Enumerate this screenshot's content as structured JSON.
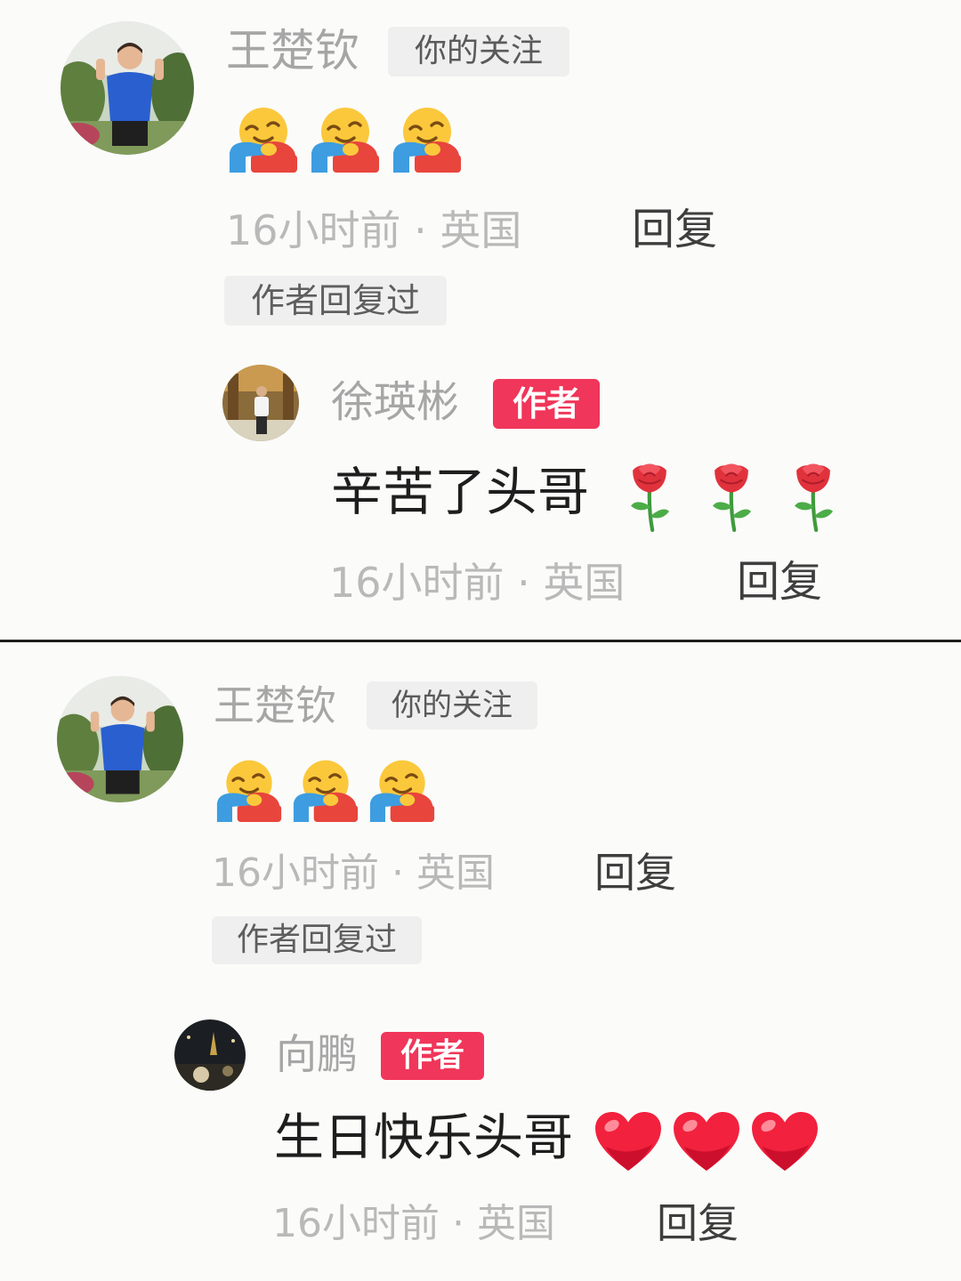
{
  "colors": {
    "background": "#fbfbfa",
    "author_badge": "#f0365a",
    "username": "#a6a6a6",
    "meta_text": "#b9b9b9",
    "tag_bg": "#efefef"
  },
  "screens": [
    {
      "comment": {
        "username": "王楚钦",
        "follow_tag": "你的关注",
        "emojis": [
          "hugging-face-emoji",
          "hugging-face-emoji",
          "hugging-face-emoji"
        ],
        "meta": "16小时前 · 英国",
        "reply_label": "回复",
        "replied_tag": "作者回复过"
      },
      "reply": {
        "username": "徐瑛彬",
        "author_tag": "作者",
        "text": "辛苦了头哥",
        "emojis": [
          "rose-emoji",
          "rose-emoji",
          "rose-emoji"
        ],
        "meta": "16小时前 · 英国",
        "reply_label": "回复"
      }
    },
    {
      "comment": {
        "username": "王楚钦",
        "follow_tag": "你的关注",
        "emojis": [
          "hugging-face-emoji",
          "hugging-face-emoji",
          "hugging-face-emoji"
        ],
        "meta": "16小时前 · 英国",
        "reply_label": "回复",
        "replied_tag": "作者回复过"
      },
      "reply": {
        "username": "向鹏",
        "author_tag": "作者",
        "text": "生日快乐头哥",
        "emojis": [
          "red-heart-emoji",
          "red-heart-emoji",
          "red-heart-emoji"
        ],
        "meta": "16小时前 · 英国",
        "reply_label": "回复"
      }
    }
  ]
}
